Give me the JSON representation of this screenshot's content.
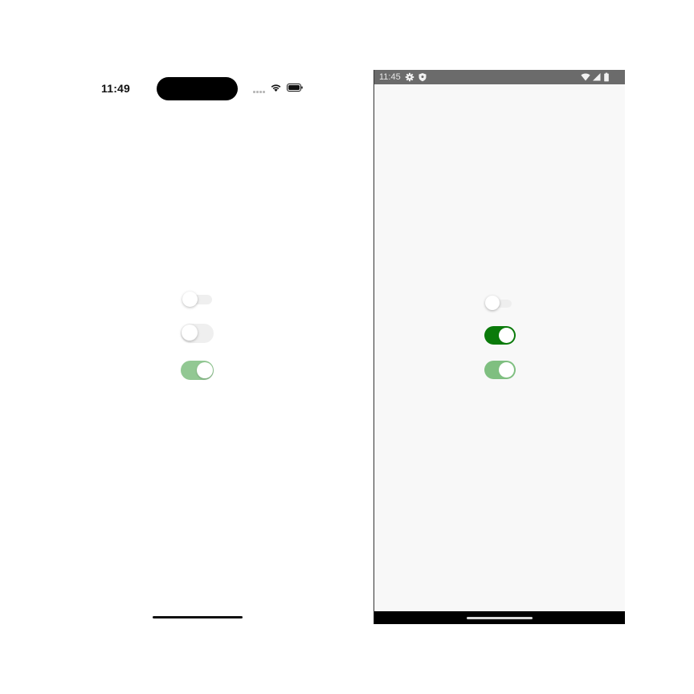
{
  "ios": {
    "status_bar": {
      "time": "11:49",
      "icons": [
        "cellular-signal-icon",
        "wifi-icon",
        "battery-icon"
      ]
    },
    "switches": [
      {
        "id": "ios-switch-1",
        "state": "off",
        "size": "small",
        "track_color": "#efefef"
      },
      {
        "id": "ios-switch-2",
        "state": "off",
        "size": "regular",
        "track_color": "#efefef"
      },
      {
        "id": "ios-switch-3",
        "state": "on",
        "size": "regular",
        "track_color": "#92c893"
      }
    ]
  },
  "android": {
    "status_bar": {
      "time": "11:45",
      "icons": [
        "gear-icon",
        "shield-icon",
        "wifi-icon",
        "cellular-signal-icon",
        "battery-icon"
      ]
    },
    "switches": [
      {
        "id": "android-switch-1",
        "state": "off",
        "size": "small",
        "track_color": "#eeeeee"
      },
      {
        "id": "android-switch-2",
        "state": "on",
        "size": "regular",
        "track_color": "#0a7a0a"
      },
      {
        "id": "android-switch-3",
        "state": "on",
        "size": "regular",
        "track_color": "#7fbf80"
      }
    ]
  },
  "colors": {
    "android_status_bar": "#6b6b6b",
    "android_background": "#f8f8f8",
    "ios_background": "#ffffff"
  }
}
